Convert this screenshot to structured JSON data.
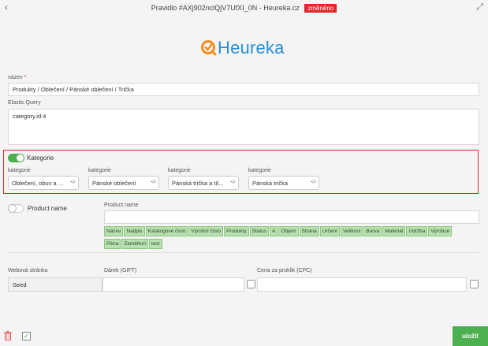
{
  "window": {
    "title": "Pravidlo #AXj902nclQjV7UfXI_0N - Heureka.cz",
    "badge": "změněno",
    "back_icon": "chevron-left-icon",
    "expand_icon": "expand-icon"
  },
  "logo": {
    "text": "Heureka",
    "color": "#2a8fd2",
    "mark_color": "#f28c1b"
  },
  "name": {
    "label": "název",
    "required_mark": "*",
    "value": "Produkty / Oblečení / Pánské oblečení / Trička"
  },
  "elastic_query": {
    "label": "Elastic Query",
    "value": "category.id:4"
  },
  "kategorie": {
    "toggle_label": "Kategorie",
    "enabled": true,
    "selects": [
      {
        "label": "kategorie",
        "value": "Oblečení, obuv a ..."
      },
      {
        "label": "kategorie",
        "value": "Pánské oblečení"
      },
      {
        "label": "kategorie",
        "value": "Pánská trička a tíl..."
      },
      {
        "label": "kategorie",
        "value": "Pánská trička"
      }
    ]
  },
  "product_name": {
    "toggle_label": "Product name",
    "enabled": false,
    "field_label": "Product name",
    "value": "",
    "tags": [
      "Název",
      "Nadpis",
      "Katalogové číslo",
      "Výrobní číslo",
      "Produkty",
      "Status",
      "A",
      "Objem",
      "Strana",
      "Určení",
      "Velikost",
      "Barva",
      "Materiál",
      "Údržba",
      "Výrobce",
      "Pěna",
      "Zaměření",
      "test"
    ]
  },
  "columns": {
    "web_label": "Webová stránka",
    "gift_label": "Dárek (GIFT)",
    "cpc_label": "Cena za proklik (CPC)",
    "web_value": "Seed",
    "gift_value": "",
    "cpc_value": ""
  },
  "footer": {
    "save_label": "uložit",
    "trash_icon": "trash-icon",
    "check_icon": "check-icon"
  },
  "colors": {
    "accent_green": "#4caf50",
    "highlight_red": "#e0262b",
    "tag_green": "#b8e0b0"
  }
}
